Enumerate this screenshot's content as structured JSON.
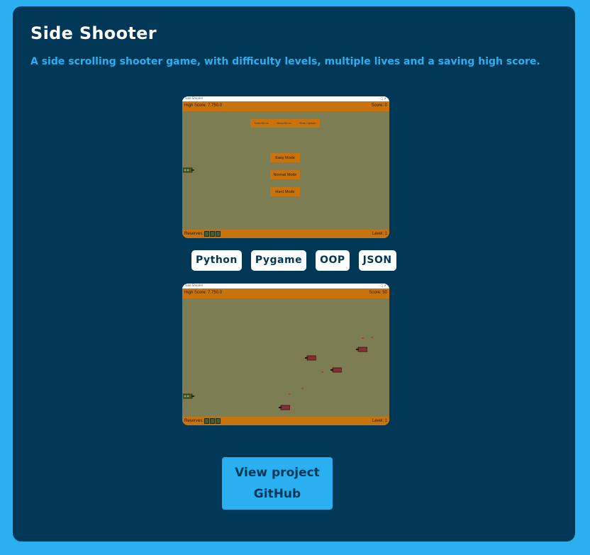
{
  "project": {
    "title": "Side Shooter",
    "description": "A side scrolling shooter game, with difficulty levels, multiple lives and a saving high score."
  },
  "screenshot_menu": {
    "window_title": "Side Shooter",
    "high_score": "High Score: 7,750.0",
    "score": "Score: 0",
    "menu_items": [
      "Music/Sfx on",
      "Music/Sfx on",
      "Show / Update"
    ],
    "modes": [
      "Easy Mode",
      "Normal Mode",
      "Hard Mode"
    ],
    "reserves_label": "Reserves:",
    "level": "Level: 1"
  },
  "screenshot_game": {
    "window_title": "Side Shooter",
    "high_score": "High Score: 7,750.0",
    "score": "Score: 50",
    "reserves_label": "Reserves:",
    "level": "Level: 1"
  },
  "tags": [
    "Python",
    "Pygame",
    "OOP",
    "JSON"
  ],
  "github_button": {
    "line1": "View project",
    "line2": "GitHub"
  },
  "colors": {
    "page_bg": "#2aaff0",
    "card_bg": "#003756",
    "accent": "#2aaff0",
    "game_ground": "#7c7d52",
    "hud_orange": "#c8730d"
  }
}
